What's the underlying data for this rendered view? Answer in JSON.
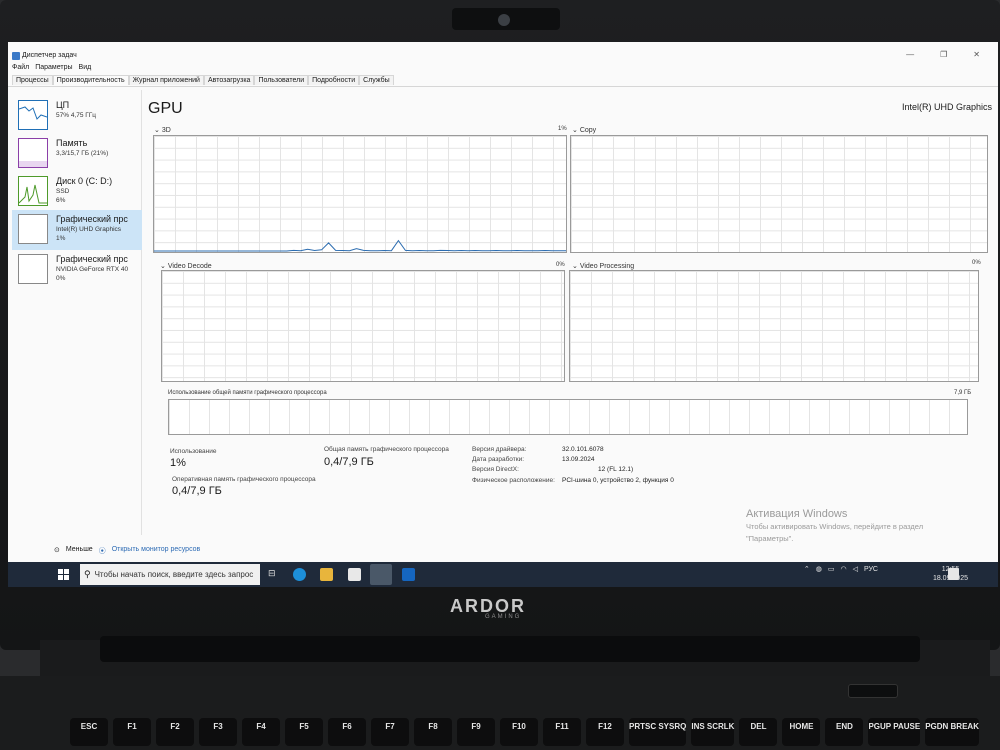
{
  "window": {
    "title": "Диспетчер задач",
    "controls": [
      "—",
      "❐",
      "✕"
    ]
  },
  "menu": [
    "Файл",
    "Параметры",
    "Вид"
  ],
  "tabs": [
    "Процессы",
    "Производительность",
    "Журнал приложений",
    "Автозагрузка",
    "Пользователи",
    "Подробности",
    "Службы"
  ],
  "sidebar": [
    {
      "title": "ЦП",
      "sub": "57% 4,75 ГГц",
      "val": ""
    },
    {
      "title": "Память",
      "sub": "3,3/15,7 ГБ (21%)",
      "val": ""
    },
    {
      "title": "Диск 0 (C: D:)",
      "sub": "SSD",
      "val": "6%"
    },
    {
      "title": "Графический прс",
      "sub": "Intel(R) UHD Graphics",
      "val": "1%"
    },
    {
      "title": "Графический прс",
      "sub": "NVIDIA GeForce RTX 40",
      "val": "0%"
    }
  ],
  "gpu": {
    "title": "GPU",
    "name": "Intel(R) UHD Graphics",
    "graphs": {
      "g3d": {
        "label": "3D",
        "pct": "1%"
      },
      "copy": {
        "label": "Copy",
        "pct": ""
      },
      "decode": {
        "label": "Video Decode",
        "pct": "0%"
      },
      "processing": {
        "label": "Video Processing",
        "pct": "0%"
      }
    },
    "shared_mem": {
      "label": "Использование общей памяти графического процессора",
      "max": "7,9 ГБ"
    },
    "stats": {
      "usage_label": "Использование",
      "usage_value": "1%",
      "shared_label": "Общая память графического процессора",
      "shared_value": "0,4/7,9 ГБ",
      "ram_label": "Оперативная память графического процессора",
      "ram_value": "0,4/7,9 ГБ"
    },
    "props": [
      {
        "label": "Версия драйвера:",
        "value": "32.0.101.6078"
      },
      {
        "label": "Дата разработки:",
        "value": "13.09.2024"
      },
      {
        "label": "Версия DirectX:",
        "value": "12 (FL 12.1)"
      },
      {
        "label": "Физическое расположение:",
        "value": "PCI-шина 0, устройство 2, функция 0"
      }
    ],
    "usage_series_3d": [
      0,
      0,
      0,
      0,
      0,
      0,
      0,
      0,
      0,
      0,
      0,
      0,
      0,
      0,
      0,
      0,
      0,
      0,
      0,
      0,
      0.5,
      0.3,
      1.5,
      0.4,
      1,
      7,
      0.5,
      0.4,
      0.3,
      2,
      0.5,
      0.3,
      0.3,
      0.4,
      0.3,
      9,
      0.5,
      0.3,
      0.4,
      0.3,
      0.3,
      0.5,
      0.4,
      0.3,
      0.4,
      0.3,
      0.4,
      0.3,
      0.3,
      0.4,
      0.3,
      0.3,
      0.4,
      0.3,
      0.3,
      0.3,
      0.4,
      0.3,
      0.3,
      0.3
    ]
  },
  "footer": {
    "less": "Меньше",
    "monitor": "Открыть монитор ресурсов"
  },
  "activation": {
    "title": "Активация Windows",
    "text1": "Чтобы активировать Windows, перейдите в раздел",
    "text2": "\"Параметры\"."
  },
  "taskbar": {
    "search_placeholder": "Чтобы начать поиск, введите здесь запрос",
    "lang": "РУС",
    "time": "12:55",
    "date": "18.09.2025"
  },
  "laptop": {
    "brand": "ARDOR",
    "brand_sub": "GAMING",
    "keys": [
      "ESC",
      "F1",
      "F2",
      "F3",
      "F4",
      "F5",
      "F6",
      "F7",
      "F8",
      "F9",
      "F10",
      "F11",
      "F12",
      "PRTSC SYSRQ",
      "INS SCRLK",
      "DEL",
      "HOME",
      "END",
      "PGUP PAUSE",
      "PGDN BREAK"
    ]
  }
}
